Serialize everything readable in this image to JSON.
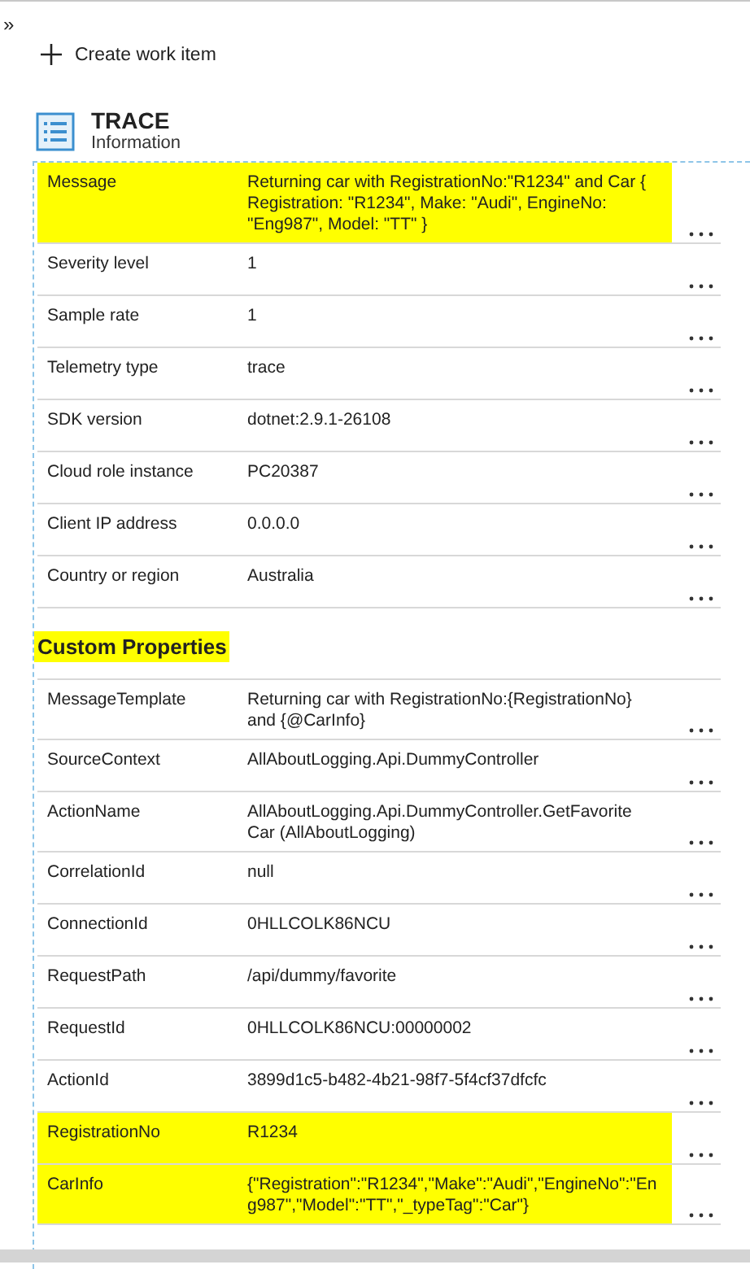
{
  "toolbar": {
    "collapse_glyph": "»",
    "create_work_item": "Create work item"
  },
  "header": {
    "title": "TRACE",
    "subtitle": "Information"
  },
  "properties": [
    {
      "label": "Message",
      "value": "Returning car with RegistrationNo:\"R1234\" and Car { Registration: \"R1234\", Make: \"Audi\", EngineNo: \"Eng987\", Model: \"TT\" }",
      "highlighted": true
    },
    {
      "label": "Severity level",
      "value": "1",
      "highlighted": false
    },
    {
      "label": "Sample rate",
      "value": "1",
      "highlighted": false
    },
    {
      "label": "Telemetry type",
      "value": "trace",
      "highlighted": false
    },
    {
      "label": "SDK version",
      "value": "dotnet:2.9.1-26108",
      "highlighted": false
    },
    {
      "label": "Cloud role instance",
      "value": "PC20387",
      "highlighted": false
    },
    {
      "label": "Client IP address",
      "value": "0.0.0.0",
      "highlighted": false
    },
    {
      "label": "Country or region",
      "value": "Australia",
      "highlighted": false
    }
  ],
  "custom_properties": {
    "title": "Custom Properties",
    "highlighted": true,
    "rows": [
      {
        "label": "MessageTemplate",
        "value": "Returning car with RegistrationNo:{RegistrationNo} and {@CarInfo}",
        "highlighted": false
      },
      {
        "label": "SourceContext",
        "value": "AllAboutLogging.Api.DummyController",
        "highlighted": false
      },
      {
        "label": "ActionName",
        "value": "AllAboutLogging.Api.DummyController.GetFavorite Car (AllAboutLogging)",
        "highlighted": false
      },
      {
        "label": "CorrelationId",
        "value": "null",
        "highlighted": false
      },
      {
        "label": "ConnectionId",
        "value": "0HLLCOLK86NCU",
        "highlighted": false
      },
      {
        "label": "RequestPath",
        "value": "/api/dummy/favorite",
        "highlighted": false
      },
      {
        "label": "RequestId",
        "value": "0HLLCOLK86NCU:00000002",
        "highlighted": false
      },
      {
        "label": "ActionId",
        "value": "3899d1c5-b482-4b21-98f7-5f4cf37dfcfc",
        "highlighted": false
      },
      {
        "label": "RegistrationNo",
        "value": "R1234",
        "highlighted": true
      },
      {
        "label": "CarInfo",
        "value": "{\"Registration\":\"R1234\",\"Make\":\"Audi\",\"EngineNo\":\"Eng987\",\"Model\":\"TT\",\"_typeTag\":\"Car\"}",
        "highlighted": true
      }
    ]
  }
}
